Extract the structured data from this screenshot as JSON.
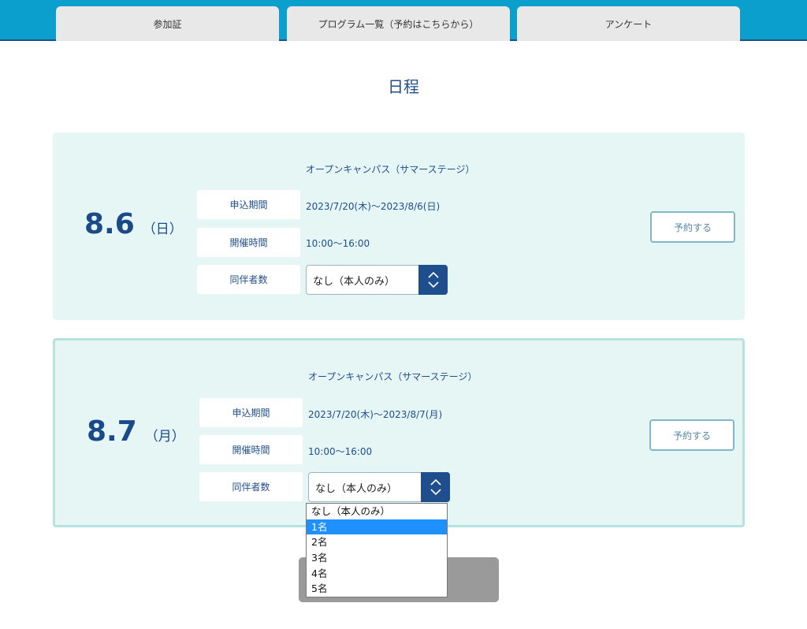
{
  "nav": {
    "tabs": [
      {
        "label": "参加証"
      },
      {
        "label": "プログラム一覧（予約はこちらから）"
      },
      {
        "label": "アンケート"
      }
    ]
  },
  "page": {
    "title": "日程"
  },
  "events": [
    {
      "date": "8.6",
      "day": "（日）",
      "program": "オープンキャンパス（サマーステージ）",
      "rows": [
        {
          "label": "申込期間",
          "value": "2023/7/20(木)〜2023/8/6(日)"
        },
        {
          "label": "開催時間",
          "value": "10:00〜16:00"
        },
        {
          "label": "同伴者数",
          "value": "なし（本人のみ）"
        }
      ],
      "reserve_label": "予約する"
    },
    {
      "date": "8.7",
      "day": "（月）",
      "program": "オープンキャンパス（サマーステージ）",
      "rows": [
        {
          "label": "申込期間",
          "value": "2023/7/20(木)〜2023/8/7(月)"
        },
        {
          "label": "開催時間",
          "value": "10:00〜16:00"
        },
        {
          "label": "同伴者数",
          "value": "なし（本人のみ）"
        }
      ],
      "reserve_label": "予約する"
    }
  ],
  "dropdown": {
    "options": [
      "なし（本人のみ）",
      "1名",
      "2名",
      "3名",
      "4名",
      "5名"
    ],
    "highlighted": "1名"
  },
  "colors": {
    "header": "#0a9fcc",
    "accent": "#1f4e8c",
    "card_bg": "#e6f6f4",
    "highlight": "#1e90ff"
  }
}
